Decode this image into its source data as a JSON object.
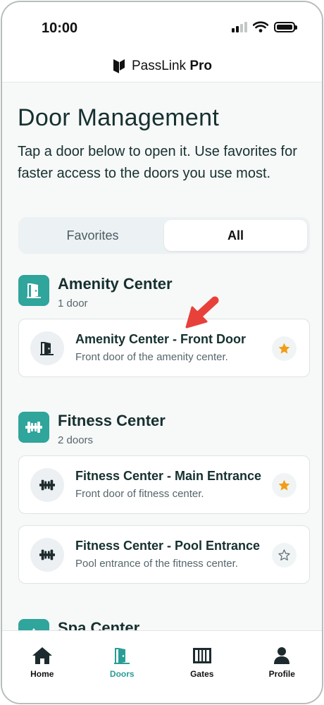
{
  "status": {
    "time": "10:00"
  },
  "brand": {
    "name_bold": "PassLink",
    "name_suffix": "Pro"
  },
  "page": {
    "title": "Door Management",
    "description": "Tap a door below to open it. Use favorites for faster access to the doors you use most."
  },
  "tabs": [
    {
      "label": "Favorites",
      "active": false
    },
    {
      "label": "All",
      "active": true
    }
  ],
  "groups": [
    {
      "title": "Amenity Center",
      "count": "1 door",
      "icon": "door-icon",
      "doors": [
        {
          "name": "Amenity Center - Front Door",
          "description": "Front door of the amenity center.",
          "favorite": true,
          "icon": "door-icon"
        }
      ]
    },
    {
      "title": "Fitness Center",
      "count": "2 doors",
      "icon": "dumbbell-icon",
      "doors": [
        {
          "name": "Fitness Center - Main Entrance",
          "description": "Front door of fitness center.",
          "favorite": true,
          "icon": "dumbbell-icon"
        },
        {
          "name": "Fitness Center - Pool Entrance",
          "description": "Pool entrance of the fitness center.",
          "favorite": false,
          "icon": "dumbbell-icon"
        }
      ]
    },
    {
      "title": "Spa Center",
      "icon": "spa-icon"
    }
  ],
  "nav": [
    {
      "label": "Home",
      "icon": "home-icon",
      "active": false
    },
    {
      "label": "Doors",
      "icon": "door-icon",
      "active": true
    },
    {
      "label": "Gates",
      "icon": "gate-icon",
      "active": false
    },
    {
      "label": "Profile",
      "icon": "person-icon",
      "active": false
    }
  ],
  "colors": {
    "accent": "#2fa59c",
    "star": "#f29d13",
    "text": "#16302f",
    "annotation": "#e8413b"
  }
}
